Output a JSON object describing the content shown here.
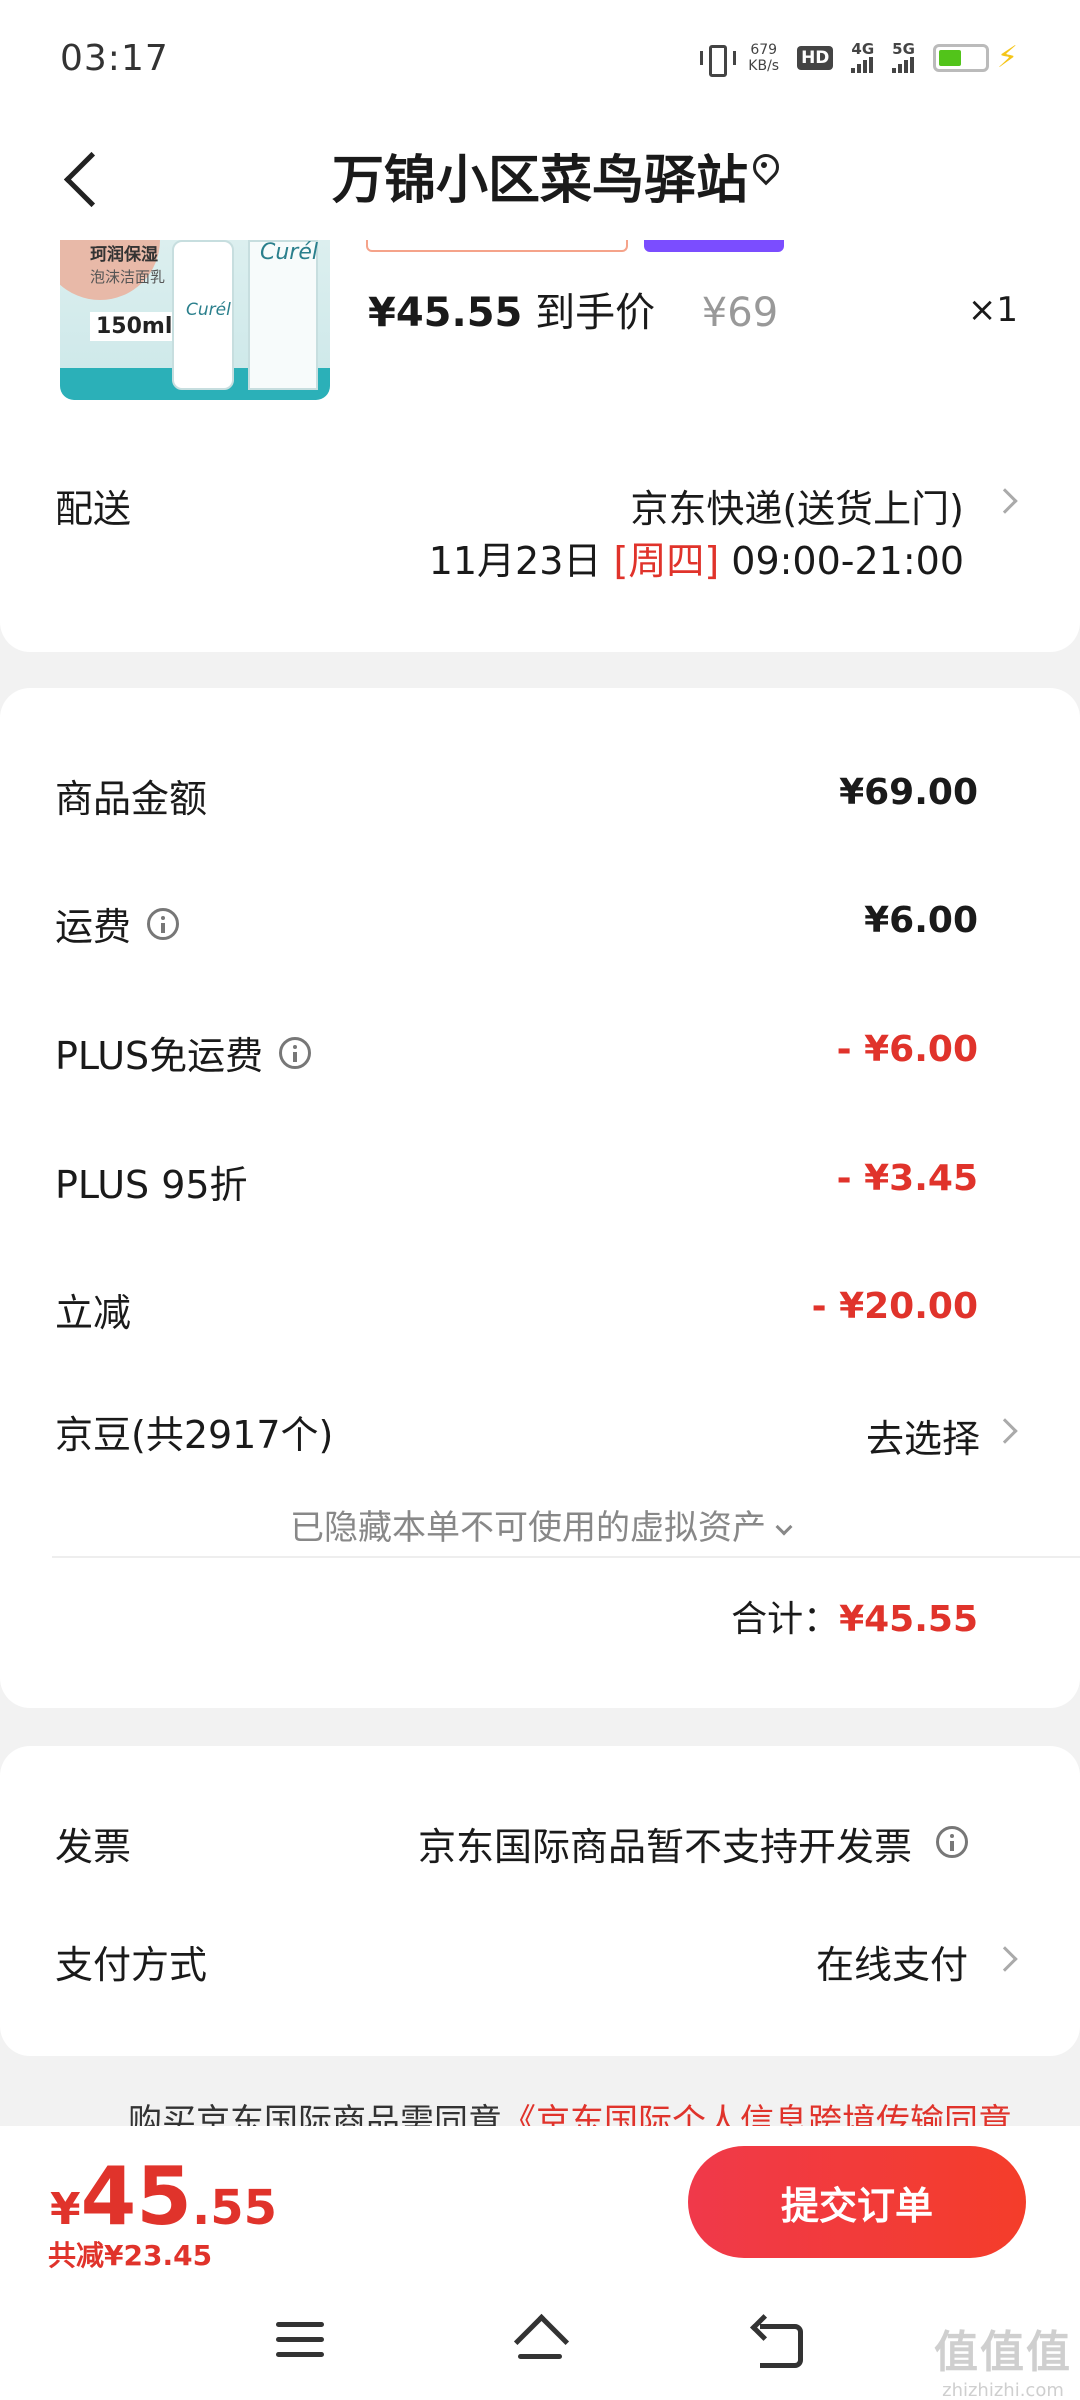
{
  "status_bar": {
    "time": "03:17",
    "net_speed_value": "679",
    "net_speed_unit": "KB/s",
    "hd": "HD",
    "sim1": "4G",
    "sim2": "5G"
  },
  "header": {
    "title": "万锦小区菜鸟驿站"
  },
  "product": {
    "image_text_1": "珂润保湿",
    "image_text_2": "泡沫洁面乳",
    "image_volume": "150ml",
    "image_brand": "Curél",
    "price_now": "¥45.55",
    "price_label": "到手价",
    "price_original": "¥69",
    "quantity": "×1"
  },
  "delivery": {
    "label": "配送",
    "method": "京东快递(送货上门)",
    "date": "11月23日",
    "weekday": "[周四]",
    "time_window": "09:00-21:00"
  },
  "amounts": {
    "goods": {
      "label": "商品金额",
      "value": "¥69.00"
    },
    "shipping": {
      "label": "运费",
      "value": "¥6.00"
    },
    "plus_free_shipping": {
      "label": "PLUS免运费",
      "value": "- ¥6.00"
    },
    "plus_discount": {
      "label": "PLUS 95折",
      "value": "- ¥3.45"
    },
    "instant_discount": {
      "label": "立减",
      "value": "- ¥20.00"
    },
    "jd_beans": {
      "label": "京豆(共2917个)",
      "action": "去选择"
    },
    "hidden_assets": "已隐藏本单不可使用的虚拟资产",
    "total_label": "合计：",
    "total_value": "¥45.55"
  },
  "invoice": {
    "label": "发票",
    "value": "京东国际商品暂不支持开发票"
  },
  "payment": {
    "label": "支付方式",
    "value": "在线支付"
  },
  "agreement": {
    "prefix": "购买京东国际商品需同意",
    "link": "《京东国际个人信息跨境传输同意"
  },
  "bottom_bar": {
    "currency": "¥",
    "total_int": "45",
    "total_dec": ".55",
    "saved": "共减¥23.45",
    "submit_label": "提交订单"
  },
  "watermark": {
    "big": "值值值",
    "small": "zhizhizhi.com"
  },
  "colors": {
    "accent_red": "#e0332b",
    "plus_purple": "#7b4dff",
    "background": "#f2f2f2"
  }
}
